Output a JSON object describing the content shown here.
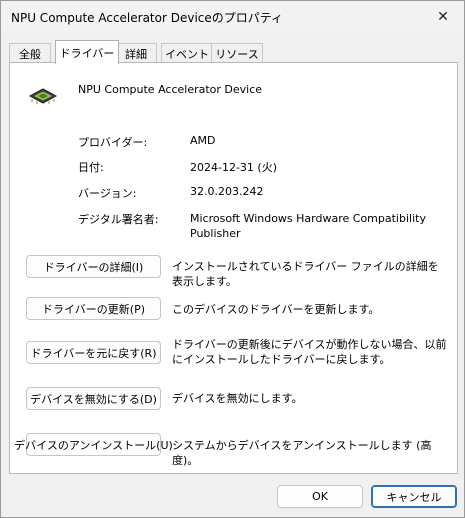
{
  "window": {
    "title": "NPU Compute Accelerator Deviceのプロパティ"
  },
  "tabs": [
    {
      "label": "全般"
    },
    {
      "label": "ドライバー"
    },
    {
      "label": "詳細"
    },
    {
      "label": "イベント"
    },
    {
      "label": "リソース"
    }
  ],
  "active_tab": "ドライバー",
  "device": {
    "name": "NPU Compute Accelerator Device",
    "icon": "chip-icon"
  },
  "properties": [
    {
      "label": "プロバイダー:",
      "value": "AMD"
    },
    {
      "label": "日付:",
      "value": "2024-12-31 (火)"
    },
    {
      "label": "バージョン:",
      "value": "32.0.203.242"
    },
    {
      "label": "デジタル署名者:",
      "value": "Microsoft Windows Hardware Compatibility Publisher"
    }
  ],
  "actions": [
    {
      "button": "ドライバーの詳細(I)",
      "description": "インストールされているドライバー ファイルの詳細を表示します。"
    },
    {
      "button": "ドライバーの更新(P)",
      "description": "このデバイスのドライバーを更新します。"
    },
    {
      "button": "ドライバーを元に戻す(R)",
      "description": "ドライバーの更新後にデバイスが動作しない場合、以前にインストールしたドライバーに戻します。"
    },
    {
      "button": "デバイスを無効にする(D)",
      "description": "デバイスを無効にします。"
    },
    {
      "button": "デバイスのアンインストール(U)",
      "description": "システムからデバイスをアンインストールします (高度)。"
    }
  ],
  "footer": {
    "ok": "OK",
    "cancel": "キャンセル"
  },
  "colors": {
    "accent": "#2f6fb3"
  }
}
